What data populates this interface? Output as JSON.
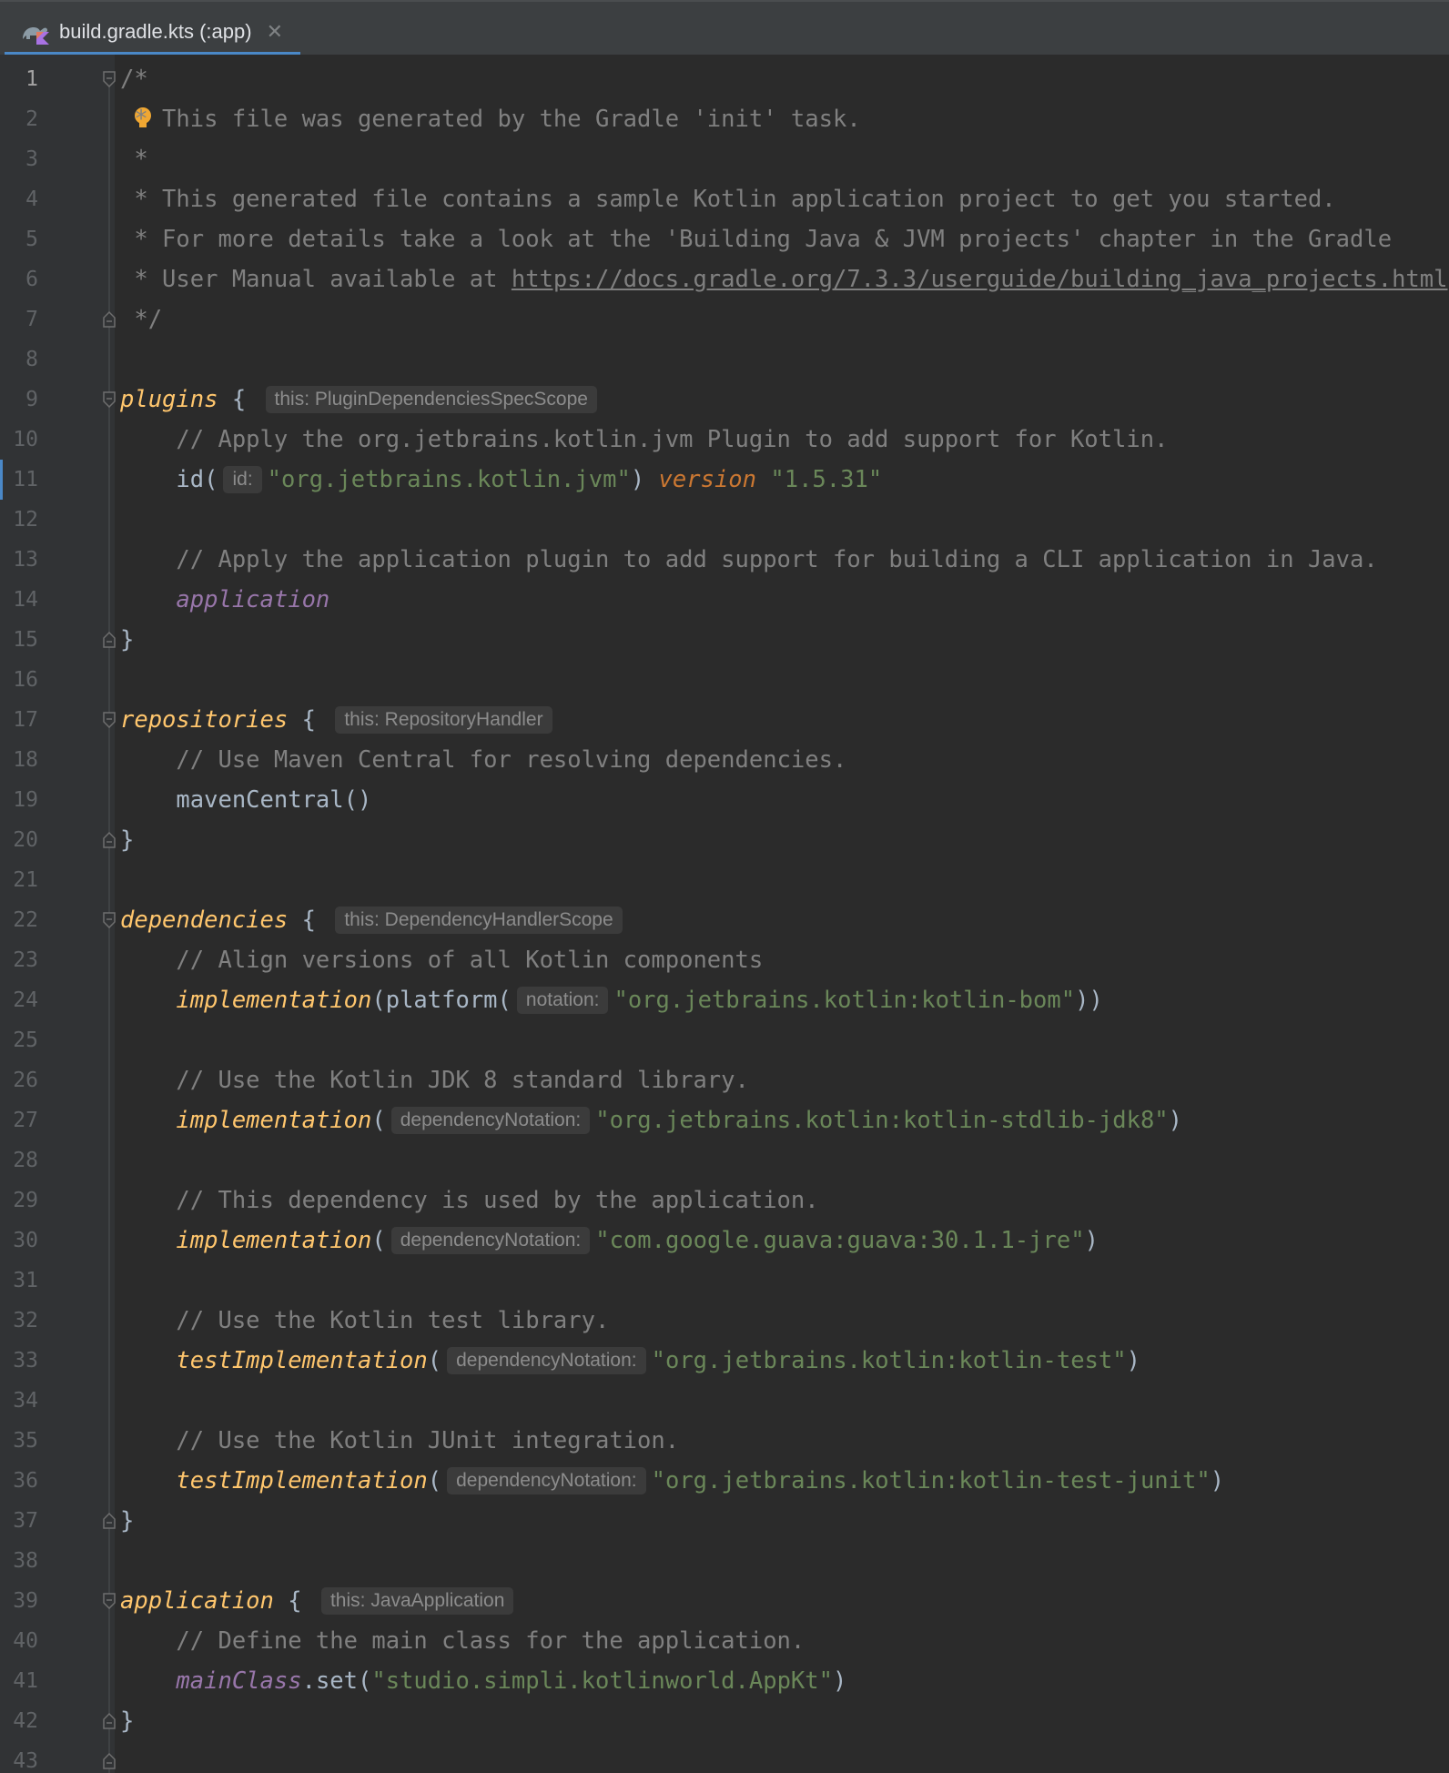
{
  "tab": {
    "title": "build.gradle.kts (:app)",
    "icon": "gradle-kotlin-icon",
    "close": "✕"
  },
  "colors": {
    "background": "#2b2b2b",
    "comment": "#808080",
    "string": "#6a8759",
    "function": "#ffc66d",
    "property": "#9876aa",
    "keyword": "#cc7832",
    "accent": "#4a88c7"
  },
  "editor": {
    "lines": [
      {
        "n": "1",
        "text": "/*"
      },
      {
        "n": "2",
        "text": " * This file was generated by the Gradle 'init' task."
      },
      {
        "n": "3",
        "text": " *"
      },
      {
        "n": "4",
        "text": " * This generated file contains a sample Kotlin application project to get you started."
      },
      {
        "n": "5",
        "text": " * For more details take a look at the 'Building Java & JVM projects' chapter in the Gradle"
      },
      {
        "n": "6",
        "text": " * User Manual available at ",
        "link": "https://docs.gradle.org/7.3.3/userguide/building_java_projects.html"
      },
      {
        "n": "7",
        "text": " */"
      },
      {
        "n": "8",
        "text": ""
      },
      {
        "n": "9",
        "fn": "plugins",
        "brace": " {",
        "hint": "this: PluginDependenciesSpecScope"
      },
      {
        "n": "10",
        "text": "    // Apply the org.jetbrains.kotlin.jvm Plugin to add support for Kotlin."
      },
      {
        "n": "11",
        "pre": "    id(",
        "hint": "id:",
        "str": "\"org.jetbrains.kotlin.jvm\"",
        "post": ") ",
        "kw": "version",
        "str2": " \"1.5.31\""
      },
      {
        "n": "12",
        "text": ""
      },
      {
        "n": "13",
        "text": "    // Apply the application plugin to add support for building a CLI application in Java."
      },
      {
        "n": "14",
        "prop": "    application"
      },
      {
        "n": "15",
        "text": "}"
      },
      {
        "n": "16",
        "text": ""
      },
      {
        "n": "17",
        "fn": "repositories",
        "brace": " {",
        "hint": "this: RepositoryHandler"
      },
      {
        "n": "18",
        "text": "    // Use Maven Central for resolving dependencies."
      },
      {
        "n": "19",
        "text": "    mavenCentral()"
      },
      {
        "n": "20",
        "text": "}"
      },
      {
        "n": "21",
        "text": ""
      },
      {
        "n": "22",
        "fn": "dependencies",
        "brace": " {",
        "hint": "this: DependencyHandlerScope"
      },
      {
        "n": "23",
        "text": "    // Align versions of all Kotlin components"
      },
      {
        "n": "24",
        "fn2": "implementation",
        "pre": "(platform(",
        "hint": "notation:",
        "str": "\"org.jetbrains.kotlin:kotlin-bom\"",
        "post": "))"
      },
      {
        "n": "25",
        "text": ""
      },
      {
        "n": "26",
        "text": "    // Use the Kotlin JDK 8 standard library."
      },
      {
        "n": "27",
        "fn2": "implementation",
        "pre": "(",
        "hint": "dependencyNotation:",
        "str": "\"org.jetbrains.kotlin:kotlin-stdlib-jdk8\"",
        "post": ")"
      },
      {
        "n": "28",
        "text": ""
      },
      {
        "n": "29",
        "text": "    // This dependency is used by the application."
      },
      {
        "n": "30",
        "fn2": "implementation",
        "pre": "(",
        "hint": "dependencyNotation:",
        "str": "\"com.google.guava:guava:30.1.1-jre\"",
        "post": ")"
      },
      {
        "n": "31",
        "text": ""
      },
      {
        "n": "32",
        "text": "    // Use the Kotlin test library."
      },
      {
        "n": "33",
        "fn2": "testImplementation",
        "pre": "(",
        "hint": "dependencyNotation:",
        "str": "\"org.jetbrains.kotlin:kotlin-test\"",
        "post": ")"
      },
      {
        "n": "34",
        "text": ""
      },
      {
        "n": "35",
        "text": "    // Use the Kotlin JUnit integration."
      },
      {
        "n": "36",
        "fn2": "testImplementation",
        "pre": "(",
        "hint": "dependencyNotation:",
        "str": "\"org.jetbrains.kotlin:kotlin-test-junit\"",
        "post": ")"
      },
      {
        "n": "37",
        "text": "}"
      },
      {
        "n": "38",
        "text": ""
      },
      {
        "n": "39",
        "fn": "application",
        "brace": " {",
        "hint": "this: JavaApplication"
      },
      {
        "n": "40",
        "text": "    // Define the main class for the application."
      },
      {
        "n": "41",
        "prop": "    mainClass",
        "pre": ".set(",
        "str": "\"studio.simpli.kotlinworld.AppKt\"",
        "post": ")"
      },
      {
        "n": "42",
        "text": "}"
      },
      {
        "n": "43",
        "text": ""
      }
    ]
  }
}
